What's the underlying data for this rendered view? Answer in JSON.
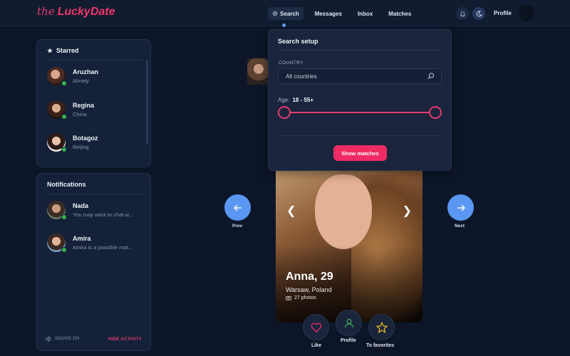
{
  "app": {
    "logo_prefix": "the",
    "logo_name": "LuckyDate"
  },
  "nav": {
    "items": [
      {
        "label": "Search",
        "icon": "gear-icon",
        "active": true
      },
      {
        "label": "Messages"
      },
      {
        "label": "Inbox"
      },
      {
        "label": "Matches"
      }
    ],
    "profile_label": "Profile",
    "bell_icon": "bell-icon",
    "theme_icon": "moon-icon"
  },
  "starred": {
    "title": "Starred",
    "people": [
      {
        "name": "Aruzhan",
        "location": "Almaty",
        "online": true
      },
      {
        "name": "Regina",
        "location": "China",
        "online": true
      },
      {
        "name": "Botagoz",
        "location": "Beijing",
        "online": true
      }
    ]
  },
  "notifications": {
    "title": "Notifications",
    "items": [
      {
        "name": "Nada",
        "message": "You may want to chat w...",
        "online": true
      },
      {
        "name": "Amira",
        "message": "Amira is a possible mat...",
        "online": true
      }
    ],
    "sound_label": "SOUND ON",
    "hide_label": "HIDE ACTIVITY"
  },
  "search_setup": {
    "title": "Search setup",
    "country_label": "COUNTRY",
    "country_value": "All countries",
    "age_label": "Age:",
    "age_value": "18 - 55+",
    "button": "Show matches"
  },
  "card": {
    "name": "Anna, 29",
    "location": "Warsaw, Poland",
    "photos": "27 photos"
  },
  "controls": {
    "prev": "Prev",
    "next": "Next",
    "like": "Like",
    "profile": "Profile",
    "favorites": "To favorites"
  },
  "colors": {
    "accent": "#ef2b63",
    "blue": "#5a97f2",
    "bg": "#0d1628",
    "panel": "#152139"
  }
}
